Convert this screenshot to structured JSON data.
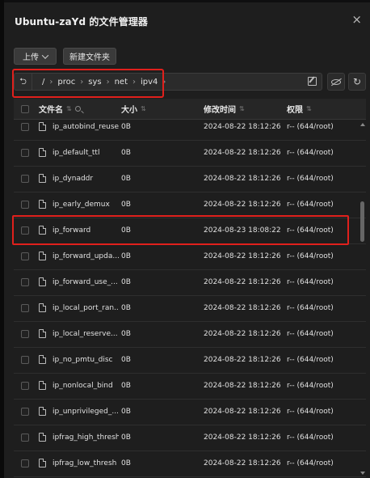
{
  "dialog": {
    "title": "Ubuntu-zaYd 的文件管理器",
    "close_icon": "×"
  },
  "toolbar": {
    "upload_label": "上传",
    "new_folder_label": "新建文件夹"
  },
  "path": {
    "back_icon": "⮌",
    "segments": [
      "/",
      "proc",
      "sys",
      "net",
      "ipv4"
    ],
    "separator": "›",
    "refresh_icon": "↻"
  },
  "table": {
    "headers": {
      "name": "文件名",
      "size": "大小",
      "mtime": "修改时间",
      "perm": "权限"
    },
    "rows": [
      {
        "name": "ip_autobind_reuse",
        "size": "0B",
        "mtime": "2024-08-22 18:12:26",
        "perm": "r-- (644/root)"
      },
      {
        "name": "ip_default_ttl",
        "size": "0B",
        "mtime": "2024-08-22 18:12:26",
        "perm": "r-- (644/root)"
      },
      {
        "name": "ip_dynaddr",
        "size": "0B",
        "mtime": "2024-08-22 18:12:26",
        "perm": "r-- (644/root)"
      },
      {
        "name": "ip_early_demux",
        "size": "0B",
        "mtime": "2024-08-22 18:12:26",
        "perm": "r-- (644/root)"
      },
      {
        "name": "ip_forward",
        "size": "0B",
        "mtime": "2024-08-23 18:08:22",
        "perm": "r-- (644/root)"
      },
      {
        "name": "ip_forward_upda...",
        "size": "0B",
        "mtime": "2024-08-22 18:12:26",
        "perm": "r-- (644/root)"
      },
      {
        "name": "ip_forward_use_...",
        "size": "0B",
        "mtime": "2024-08-22 18:12:26",
        "perm": "r-- (644/root)"
      },
      {
        "name": "ip_local_port_ran...",
        "size": "0B",
        "mtime": "2024-08-22 18:12:26",
        "perm": "r-- (644/root)"
      },
      {
        "name": "ip_local_reserve...",
        "size": "0B",
        "mtime": "2024-08-22 18:12:26",
        "perm": "r-- (644/root)"
      },
      {
        "name": "ip_no_pmtu_disc",
        "size": "0B",
        "mtime": "2024-08-22 18:12:26",
        "perm": "r-- (644/root)"
      },
      {
        "name": "ip_nonlocal_bind",
        "size": "0B",
        "mtime": "2024-08-22 18:12:26",
        "perm": "r-- (644/root)"
      },
      {
        "name": "ip_unprivileged_...",
        "size": "0B",
        "mtime": "2024-08-22 18:12:26",
        "perm": "r-- (644/root)"
      },
      {
        "name": "ipfrag_high_thresh",
        "size": "0B",
        "mtime": "2024-08-22 18:12:26",
        "perm": "r-- (644/root)"
      },
      {
        "name": "ipfrag_low_thresh",
        "size": "0B",
        "mtime": "2024-08-22 18:12:26",
        "perm": "r-- (644/root)"
      }
    ]
  },
  "colors": {
    "highlight": "#e0201c",
    "background": "#1e1e1e"
  }
}
